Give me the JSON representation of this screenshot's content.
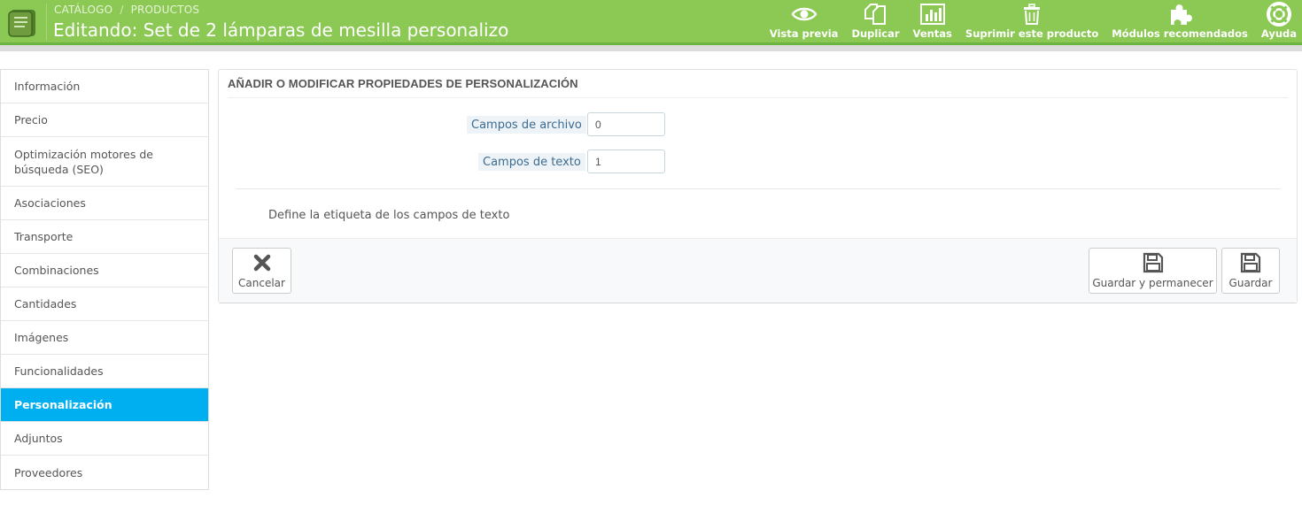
{
  "header": {
    "breadcrumb": [
      "CATÁLOGO",
      "PRODUCTOS"
    ],
    "breadcrumb_separator": "/",
    "title": "Editando: Set de 2 lámparas de mesilla personalizo",
    "accent_color": "#8bc954"
  },
  "toolbar": [
    {
      "label": "Vista previa",
      "icon": "eye-icon"
    },
    {
      "label": "Duplicar",
      "icon": "copy-icon"
    },
    {
      "label": "Ventas",
      "icon": "bar-chart-icon"
    },
    {
      "label": "Suprimir este producto",
      "icon": "trash-icon"
    },
    {
      "label": "Módulos recomendados",
      "icon": "puzzle-icon"
    },
    {
      "label": "Ayuda",
      "icon": "lifebuoy-icon"
    }
  ],
  "sidebar": {
    "items": [
      {
        "label": "Información"
      },
      {
        "label": "Precio"
      },
      {
        "label": "Optimización motores de búsqueda (SEO)"
      },
      {
        "label": "Asociaciones"
      },
      {
        "label": "Transporte"
      },
      {
        "label": "Combinaciones"
      },
      {
        "label": "Cantidades"
      },
      {
        "label": "Imágenes"
      },
      {
        "label": "Funcionalidades"
      },
      {
        "label": "Personalización",
        "active": true
      },
      {
        "label": "Adjuntos"
      },
      {
        "label": "Proveedores"
      }
    ],
    "active_color": "#00aff0"
  },
  "panel": {
    "heading": "AÑADIR O MODIFICAR PROPIEDADES DE PERSONALIZACIÓN",
    "fields": {
      "file_fields": {
        "label": "Campos de archivo",
        "value": "0"
      },
      "text_fields": {
        "label": "Campos de texto",
        "value": "1"
      }
    },
    "define_text": "Define la etiqueta de los campos de texto",
    "buttons": {
      "cancel": "Cancelar",
      "save_stay": "Guardar y permanecer",
      "save": "Guardar"
    }
  }
}
